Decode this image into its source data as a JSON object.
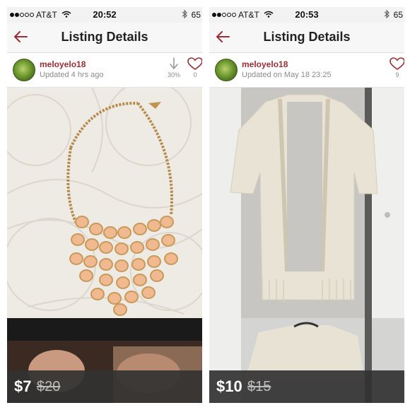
{
  "panels": [
    {
      "status": {
        "carrier": "AT&T",
        "time": "20:52",
        "battery": "65"
      },
      "nav": {
        "title": "Listing Details"
      },
      "user": {
        "name": "meloyelo18",
        "updated": "Updated 4 hrs ago"
      },
      "stats": {
        "drop_percent": "30%",
        "likes": "0"
      },
      "price": {
        "current": "$7",
        "original": "$20"
      }
    },
    {
      "status": {
        "carrier": "AT&T",
        "time": "20:53",
        "battery": "65"
      },
      "nav": {
        "title": "Listing Details"
      },
      "user": {
        "name": "meloyelo18",
        "updated": "Updated on May 18 23:25"
      },
      "stats": {
        "likes": "9"
      },
      "price": {
        "current": "$10",
        "original": "$15"
      }
    }
  ],
  "colors": {
    "accent": "#9b2d35",
    "price_bar": "#323232"
  },
  "icons": [
    "back-arrow-icon",
    "wifi-icon",
    "bluetooth-icon",
    "price-drop-icon",
    "heart-icon"
  ]
}
